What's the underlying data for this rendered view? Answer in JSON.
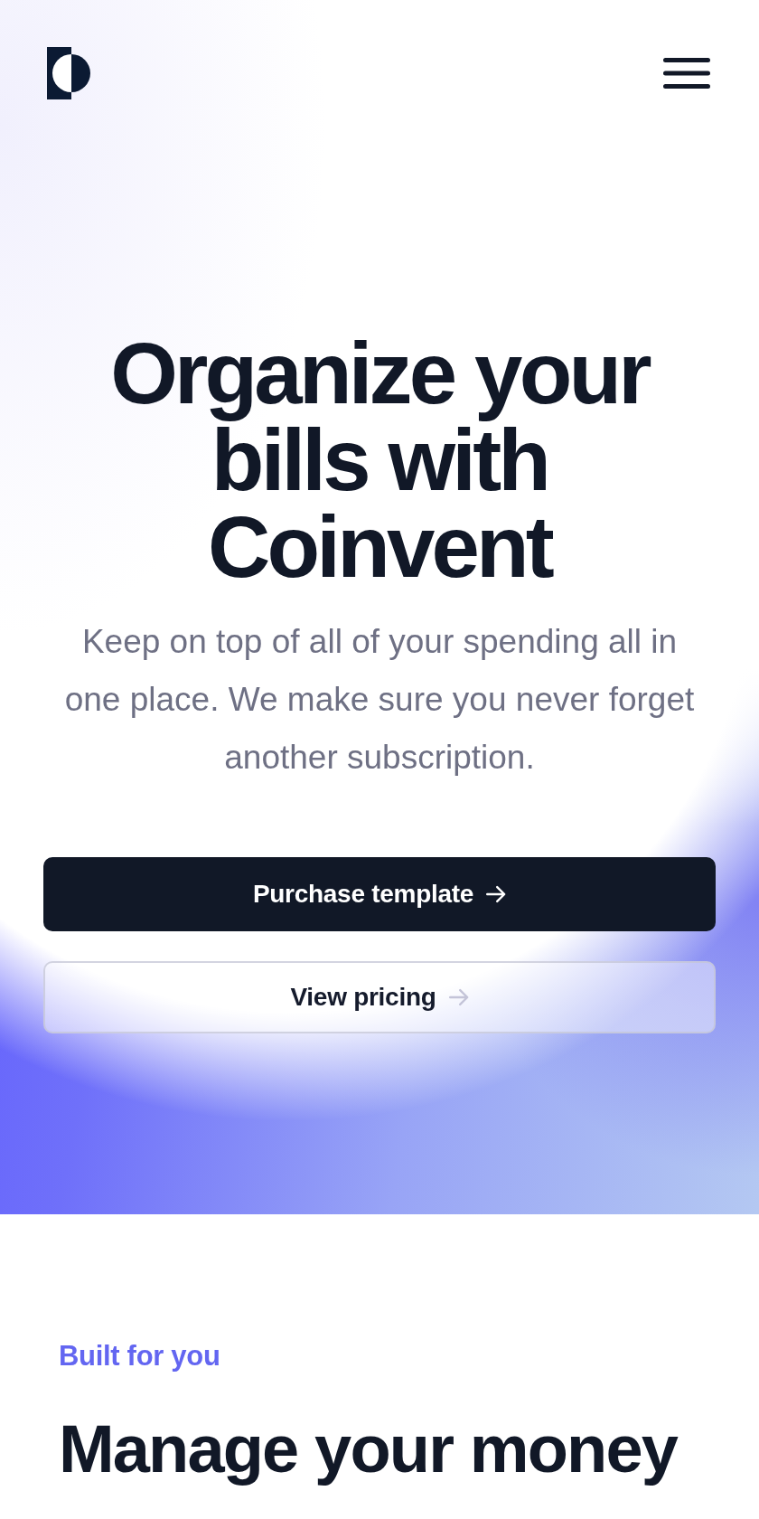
{
  "hero": {
    "title": "Organize your bills with Coinvent",
    "subtitle": "Keep on top of all of your spending all in one place. We make sure you never forget another subscription.",
    "buttons": [
      {
        "label": "Purchase template",
        "kind": "primary"
      },
      {
        "label": "View pricing",
        "kind": "secondary"
      }
    ]
  },
  "features": {
    "eyebrow": "Built for you",
    "title": "Manage your money"
  }
}
